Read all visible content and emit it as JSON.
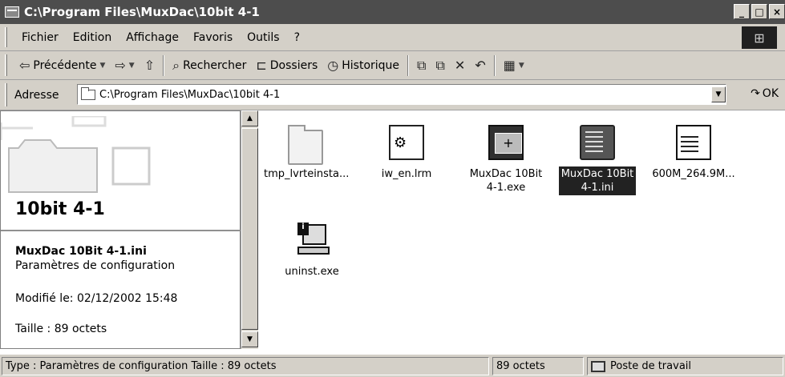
{
  "window": {
    "title": "C:\\Program Files\\MuxDac\\10bit 4-1",
    "buttons": {
      "minimize": "_",
      "maximize": "□",
      "close": "×"
    }
  },
  "menu": [
    {
      "label": "Fichier"
    },
    {
      "label": "Edition"
    },
    {
      "label": "Affichage"
    },
    {
      "label": "Favoris"
    },
    {
      "label": "Outils"
    },
    {
      "label": "?"
    }
  ],
  "toolbar": {
    "back": "Précédente",
    "search": "Rechercher",
    "folders": "Dossiers",
    "history": "Historique"
  },
  "address": {
    "label": "Adresse",
    "value": "C:\\Program Files\\MuxDac\\10bit 4-1",
    "go": "OK"
  },
  "details": {
    "folder_title": "10bit 4-1",
    "file_name": "MuxDac 10Bit 4-1.ini",
    "file_type": "Paramètres de configuration",
    "modified": "Modifié le: 02/12/2002 15:48",
    "size": "Taille : 89 octets"
  },
  "files": [
    {
      "label": "tmp_lvrteinsta...",
      "icon": "folder-icon"
    },
    {
      "label": "iw_en.lrm",
      "icon": "document-icon"
    },
    {
      "label": "MuxDac 10Bit\n4-1.exe",
      "icon": "application-icon"
    },
    {
      "label": "MuxDac 10Bit\n4-1.ini",
      "icon": "config-file-icon",
      "selected": true
    },
    {
      "label": "600M_264.9M...",
      "icon": "notepad-icon"
    },
    {
      "label": "uninst.exe",
      "icon": "installer-icon"
    }
  ],
  "status": {
    "type_info": "Type : Paramètres de configuration Taille  : 89 octets",
    "size": "89 octets",
    "zone": "Poste de travail"
  }
}
